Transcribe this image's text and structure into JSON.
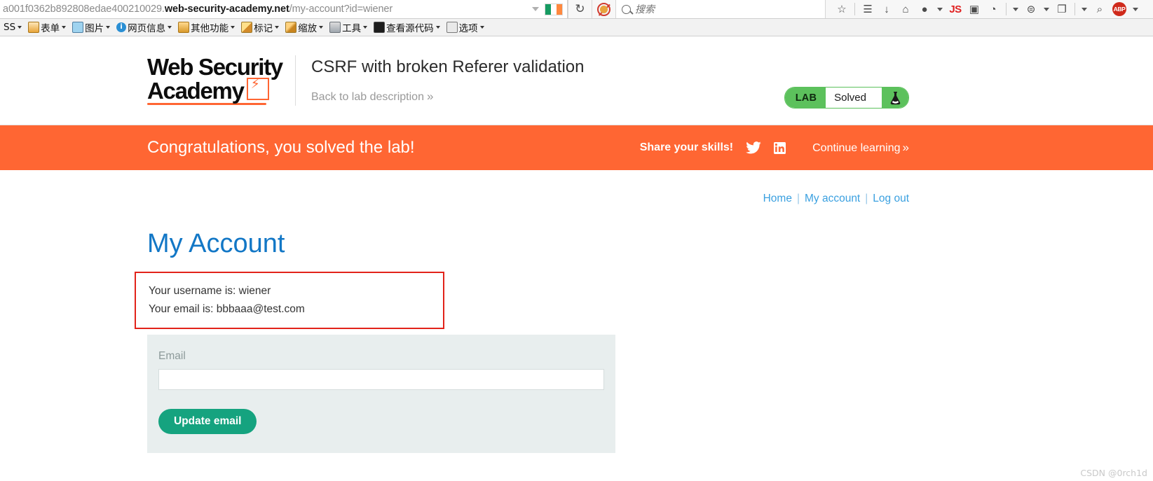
{
  "browser": {
    "url_subdomain": "a001f0362b892808edae400210029.",
    "url_host": "web-security-academy.net",
    "url_path": "/my-account?id=wiener",
    "search_placeholder": "搜索",
    "reload_glyph": "↻",
    "icons": [
      {
        "name": "bookmark-star-icon",
        "glyph": "☆"
      },
      {
        "name": "reading-list-icon",
        "glyph": "☰"
      },
      {
        "name": "downloads-icon",
        "glyph": "↓"
      },
      {
        "name": "home-icon",
        "glyph": "⌂"
      },
      {
        "name": "globe-icon",
        "glyph": "●"
      },
      {
        "name": "javascript-toggle-icon",
        "glyph": "JS"
      },
      {
        "name": "image-export-icon",
        "glyph": "▣"
      },
      {
        "name": "palette-icon",
        "glyph": "◔"
      },
      {
        "name": "user-agent-icon",
        "glyph": "⊜"
      },
      {
        "name": "page-copy-icon",
        "glyph": "❐"
      },
      {
        "name": "zoom-search-icon",
        "glyph": "⌕"
      },
      {
        "name": "adblock-plus-icon",
        "glyph": "ABP"
      }
    ],
    "devbar": [
      {
        "label": "SS",
        "icon": "css-icon"
      },
      {
        "label": "表单",
        "icon": "forms-icon"
      },
      {
        "label": "图片",
        "icon": "images-icon"
      },
      {
        "label": "网页信息",
        "icon": "information-icon"
      },
      {
        "label": "其他功能",
        "icon": "miscellaneous-icon"
      },
      {
        "label": "标记",
        "icon": "outline-icon"
      },
      {
        "label": "缩放",
        "icon": "resize-icon"
      },
      {
        "label": "工具",
        "icon": "tools-icon"
      },
      {
        "label": "查看源代码",
        "icon": "view-source-icon"
      },
      {
        "label": "选项",
        "icon": "options-icon"
      }
    ]
  },
  "header": {
    "logo_line1": "Web Security",
    "logo_line2": "Academy",
    "lab_title": "CSRF with broken Referer validation",
    "back_link": "Back to lab description",
    "chevron": "»",
    "badge": {
      "tag": "LAB",
      "status": "Solved",
      "accent_color": "#5cc15c"
    }
  },
  "banner": {
    "message": "Congratulations, you solved the lab!",
    "share_label": "Share your skills!",
    "continue_label": "Continue learning",
    "chevron": "»",
    "background_color": "#ff6633",
    "twitter_icon": "twitter-icon",
    "linkedin_icon": "linkedin-icon"
  },
  "account_nav": {
    "home": "Home",
    "my_account": "My account",
    "log_out": "Log out",
    "separator": "|"
  },
  "account": {
    "title": "My Account",
    "username_line": "Your username is: wiener",
    "email_line": "Your email is: bbbaaa@test.com",
    "highlight_color": "#e2231a"
  },
  "email_form": {
    "label": "Email",
    "input_value": "",
    "input_placeholder": "",
    "button_label": "Update email",
    "button_color": "#15a37f"
  },
  "watermark": "CSDN @0rch1d"
}
